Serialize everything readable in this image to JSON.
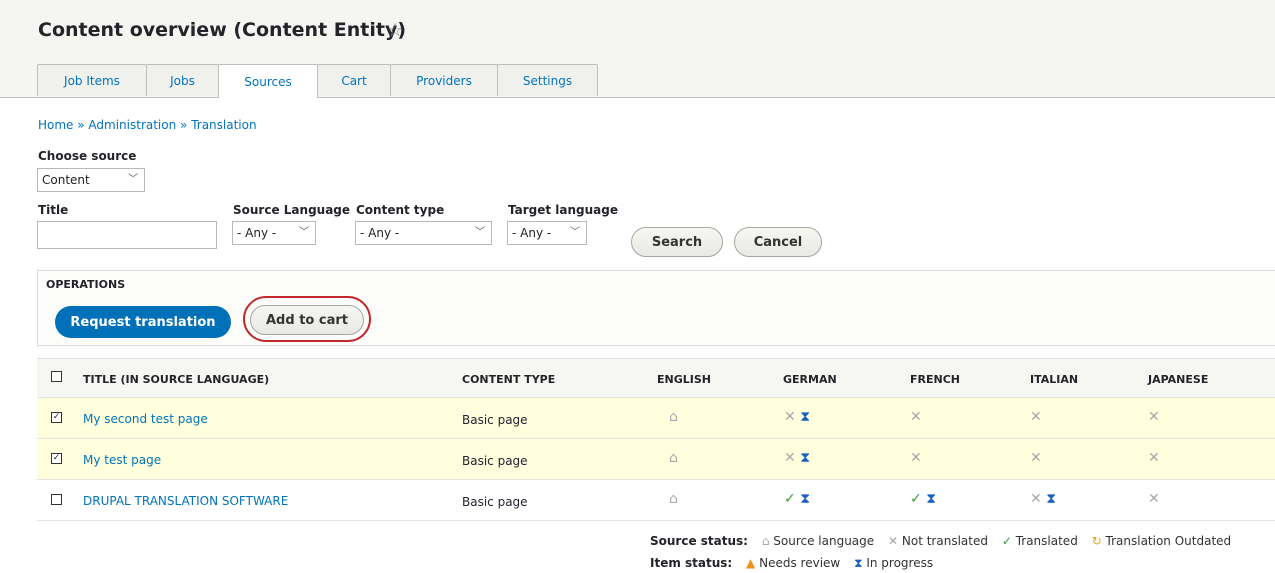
{
  "page": {
    "title": "Content overview (Content Entity)",
    "star_icon": "star-icon"
  },
  "tabs": [
    {
      "label": "Job Items",
      "active": false
    },
    {
      "label": "Jobs",
      "active": false
    },
    {
      "label": "Sources",
      "active": true
    },
    {
      "label": "Cart",
      "active": false
    },
    {
      "label": "Providers",
      "active": false
    },
    {
      "label": "Settings",
      "active": false
    }
  ],
  "breadcrumb": "Home » Administration » Translation",
  "filters": {
    "choose_source_label": "Choose source",
    "choose_source_value": "Content",
    "title_label": "Title",
    "title_value": "",
    "source_language_label": "Source Language",
    "source_language_value": "- Any -",
    "content_type_label": "Content type",
    "content_type_value": "- Any -",
    "target_language_label": "Target language",
    "target_language_value": "- Any -",
    "search_label": "Search",
    "cancel_label": "Cancel"
  },
  "operations": {
    "title": "OPERATIONS",
    "request_label": "Request translation",
    "add_to_cart_label": "Add to cart"
  },
  "table": {
    "headers": [
      "TITLE (IN SOURCE LANGUAGE)",
      "CONTENT TYPE",
      "ENGLISH",
      "GERMAN",
      "FRENCH",
      "ITALIAN",
      "JAPANESE"
    ],
    "rows": [
      {
        "checked": true,
        "title": "My second test page",
        "type": "Basic page"
      },
      {
        "checked": true,
        "title": "My test page",
        "type": "Basic page"
      },
      {
        "checked": false,
        "title": "DRUPAL TRANSLATION SOFTWARE",
        "type": "Basic page"
      }
    ]
  },
  "glyphs": {
    "home": "⌂",
    "cross": "✕",
    "check": "✓",
    "hourglass": "⧗",
    "triangle": "▲",
    "outdated": "↻",
    "checkbox_checked": "✓"
  },
  "legend": {
    "source_status_label": "Source status:",
    "source_language": "Source language",
    "not_translated": "Not translated",
    "translated": "Translated",
    "outdated": "Translation Outdated",
    "item_status_label": "Item status:",
    "needs_review": "Needs review",
    "in_progress": "In progress"
  },
  "colors": {
    "link": "#0074bd",
    "primary": "#0071b8",
    "highlight_row": "#ffffdd",
    "ring": "#c12a2a"
  }
}
